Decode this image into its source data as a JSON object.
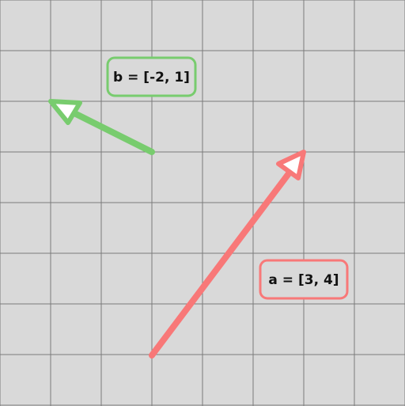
{
  "diagram": {
    "background": "#d9d9d9",
    "grid_color": "#7a7a7a",
    "vectors": [
      {
        "name": "a",
        "label": "a = [3, 4]",
        "components": [
          3,
          4
        ],
        "color": "#f87878",
        "label_border": "#f87878"
      },
      {
        "name": "b",
        "label": "b = [-2, 1]",
        "components": [
          -2,
          1
        ],
        "color": "#78cc6e",
        "label_border": "#78cc6e"
      }
    ]
  }
}
